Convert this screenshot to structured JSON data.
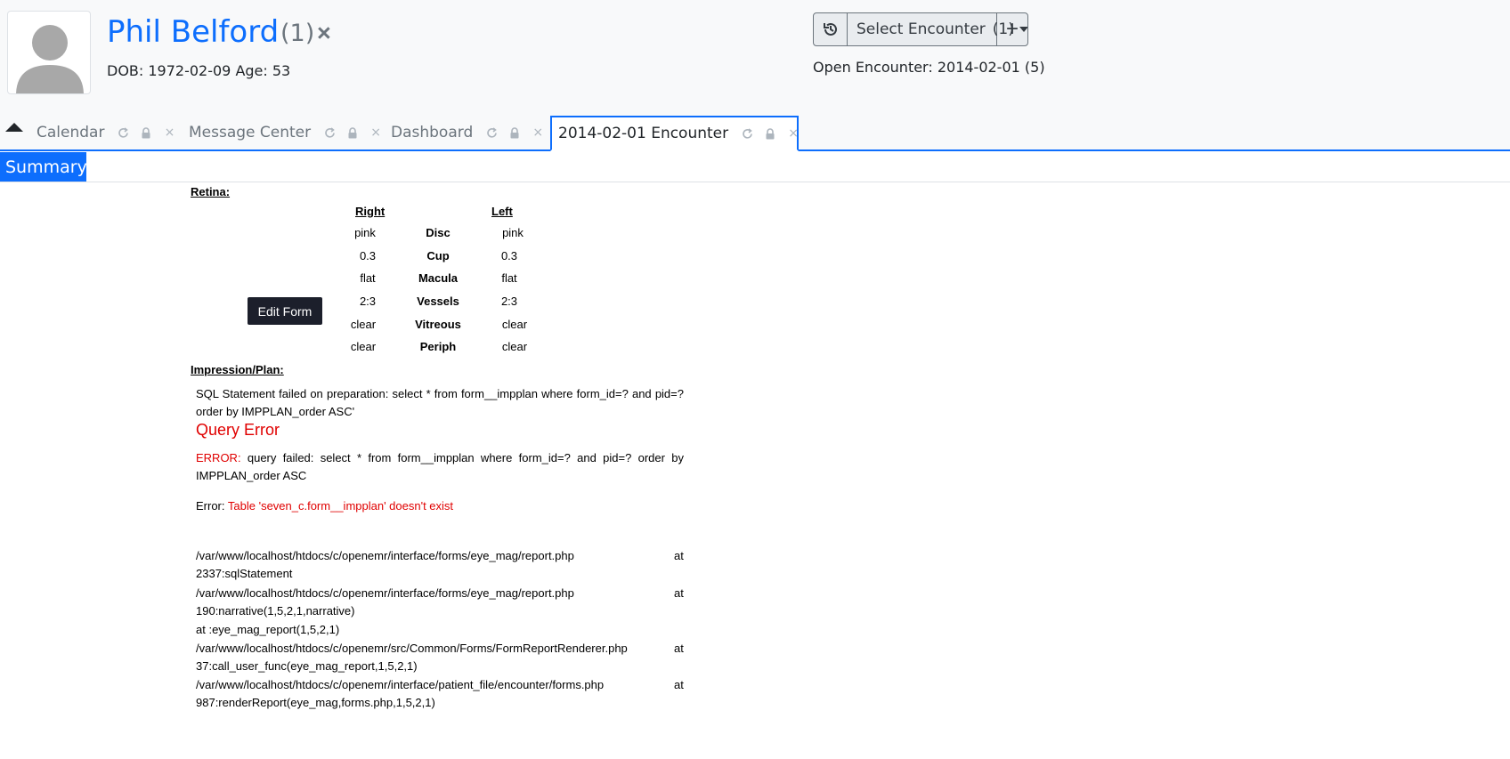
{
  "header": {
    "patient_name": "Phil Belford",
    "patient_count": "(1)",
    "close_glyph": "×",
    "dob_line": "DOB: 1972-02-09 Age: 53",
    "encounter_select_label": "Select Encounter",
    "encounter_select_count": "(1)",
    "add_glyph": "+",
    "open_encounter": "Open Encounter: 2014-02-01 (5)"
  },
  "tabs": [
    {
      "label": "Calendar"
    },
    {
      "label": "Message Center"
    },
    {
      "label": "Dashboard"
    },
    {
      "label": "2014-02-01 Encounter",
      "active": true
    }
  ],
  "tab_icons": {
    "refresh": "refresh-icon",
    "lock": "lock-icon",
    "close": "×"
  },
  "summary_tab": "Summary",
  "retina": {
    "title": "Retina:",
    "right_head": "Right",
    "left_head": "Left",
    "rows": [
      {
        "right": "pink",
        "label": "Disc",
        "left": "pink"
      },
      {
        "right": "0.3",
        "label": "Cup",
        "left": "0.3"
      },
      {
        "right": "flat",
        "label": "Macula",
        "left": "flat"
      },
      {
        "right": "2:3",
        "label": "Vessels",
        "left": "2:3"
      },
      {
        "right": "clear",
        "label": "Vitreous",
        "left": "clear"
      },
      {
        "right": "clear",
        "label": "Periph",
        "left": "clear"
      }
    ]
  },
  "edit_form_label": "Edit Form",
  "impplan": {
    "title": "Impression/Plan:",
    "sql_statement": "SQL Statement failed on preparation: select * from form__impplan where form_id=? and pid=? order by IMPPLAN_order ASC'",
    "query_error": "Query Error",
    "error_prefix": "ERROR:",
    "error_text": " query failed: select * from form__impplan where form_id=? and pid=? order by IMPPLAN_order ASC",
    "error2_prefix": "Error: ",
    "error2_text": "Table 'seven_c.form__impplan' doesn't exist"
  },
  "trace": [
    {
      "path": "/var/www/localhost/htdocs/c/openemr/interface/forms/eye_mag/report.php",
      "at": "at",
      "line2": "2337:sqlStatement"
    },
    {
      "path": "/var/www/localhost/htdocs/c/openemr/interface/forms/eye_mag/report.php",
      "at": "at",
      "line2": "190:narrative(1,5,2,1,narrative)"
    },
    {
      "path": "at :eye_mag_report(1,5,2,1)",
      "at": "",
      "line2": ""
    },
    {
      "path": "/var/www/localhost/htdocs/c/openemr/src/Common/Forms/FormReportRenderer.php",
      "at": "at",
      "line2": "37:call_user_func(eye_mag_report,1,5,2,1)"
    },
    {
      "path": "/var/www/localhost/htdocs/c/openemr/interface/patient_file/encounter/forms.php",
      "at": "at",
      "line2": "987:renderReport(eye_mag,forms.php,1,5,2,1)"
    }
  ],
  "colors": {
    "primary": "#0d6efd",
    "error": "#e00000",
    "muted": "#6c757d"
  }
}
